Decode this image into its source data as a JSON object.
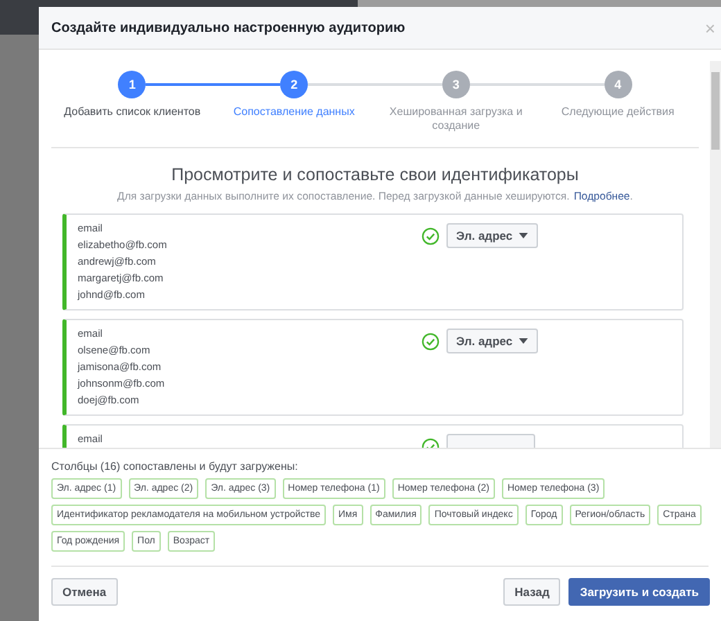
{
  "dialog": {
    "title": "Создайте индивидуально настроенную аудиторию",
    "close": "×"
  },
  "steps": [
    {
      "number": "1",
      "label": "Добавить список клиентов",
      "completed": true,
      "selected": false
    },
    {
      "number": "2",
      "label": "Сопоставление данных",
      "completed": false,
      "selected": true
    },
    {
      "number": "3",
      "label": "Хешированная загрузка и создание",
      "completed": false,
      "selected": false
    },
    {
      "number": "4",
      "label": "Следующие действия",
      "completed": false,
      "selected": false
    }
  ],
  "heading": "Просмотрите и сопоставьте свои идентификаторы",
  "subtitle": "Для загрузки данных выполните их сопоставление. Перед загрузкой данные хешируются.",
  "subtitle_link": "Подробнее",
  "subtitle_end": ".",
  "columns": [
    {
      "header": "email",
      "values": [
        "elizabetho@fb.com",
        "andrewj@fb.com",
        "margaretj@fb.com",
        "johnd@fb.com"
      ],
      "matched": true,
      "mapping": "Эл. адрес"
    },
    {
      "header": "email",
      "values": [
        "olsene@fb.com",
        "jamisona@fb.com",
        "johnsonm@fb.com",
        "doej@fb.com"
      ],
      "matched": true,
      "mapping": "Эл. адрес"
    },
    {
      "header": "email",
      "matched": true
    }
  ],
  "summary": "Столбцы (16) сопоставлены и будут загружены:",
  "tags": [
    "Эл. адрес (1)",
    "Эл. адрес (2)",
    "Эл. адрес (3)",
    "Номер телефона (1)",
    "Номер телефона (2)",
    "Номер телефона (3)",
    "Идентификатор рекламодателя на мобильном устройстве",
    "Имя",
    "Фамилия",
    "Почтовый индекс",
    "Город",
    "Регион/область",
    "Страна",
    "Год рождения",
    "Пол",
    "Возраст"
  ],
  "buttons": {
    "cancel": "Отмена",
    "back": "Назад",
    "submit": "Загрузить и создать"
  }
}
